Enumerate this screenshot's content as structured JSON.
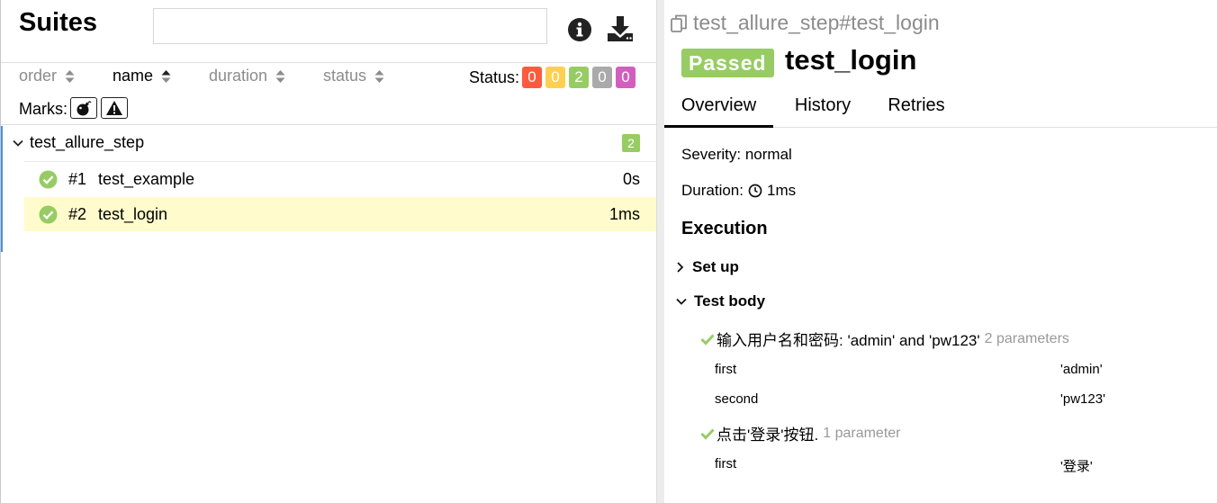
{
  "left_pane": {
    "title": "Suites",
    "search": {
      "value": "",
      "placeholder": ""
    },
    "toolbar": {
      "info_icon": "info-circle-icon",
      "download_icon": "download-icon"
    },
    "sort": [
      {
        "label": "order",
        "active": false
      },
      {
        "label": "name",
        "active": true
      },
      {
        "label": "duration",
        "active": false
      },
      {
        "label": "status",
        "active": false
      }
    ],
    "status": {
      "label": "Status:",
      "counts": [
        {
          "name": "failed",
          "value": "0",
          "color": "#fd5a3e"
        },
        {
          "name": "broken",
          "value": "0",
          "color": "#ffd050"
        },
        {
          "name": "passed",
          "value": "2",
          "color": "#97cc64"
        },
        {
          "name": "skipped",
          "value": "0",
          "color": "#aaaaaa"
        },
        {
          "name": "unknown",
          "value": "0",
          "color": "#d35ebe"
        }
      ]
    },
    "marks": {
      "label": "Marks:",
      "icons": [
        "bomb-icon",
        "warning-icon"
      ]
    },
    "tree": {
      "group_name": "test_allure_step",
      "group_count": "2",
      "items": [
        {
          "num": "#1",
          "name": "test_example",
          "duration": "0s",
          "status": "passed",
          "selected": false
        },
        {
          "num": "#2",
          "name": "test_login",
          "duration": "1ms",
          "status": "passed",
          "selected": true
        }
      ]
    }
  },
  "right_pane": {
    "breadcrumb": "test_allure_step#test_login",
    "status_badge": "Passed",
    "test_title": "test_login",
    "tabs": [
      "Overview",
      "History",
      "Retries"
    ],
    "active_tab": "Overview",
    "severity": "Severity: normal",
    "duration_label": "Duration:",
    "duration_value": "1ms",
    "execution_heading": "Execution",
    "setup_label": "Set up",
    "test_body_label": "Test body",
    "steps": [
      {
        "name": "输入用户名和密码: 'admin' and 'pw123'",
        "params_label": "2 parameters",
        "params": [
          {
            "name": "first",
            "value": "'admin'"
          },
          {
            "name": "second",
            "value": "'pw123'"
          }
        ]
      },
      {
        "name": "点击'登录'按钮.",
        "params_label": "1 parameter",
        "params": [
          {
            "name": "first",
            "value": "'登录'"
          }
        ]
      }
    ]
  },
  "colors": {
    "passed": "#97cc64",
    "selected_row": "#fffbcc"
  }
}
